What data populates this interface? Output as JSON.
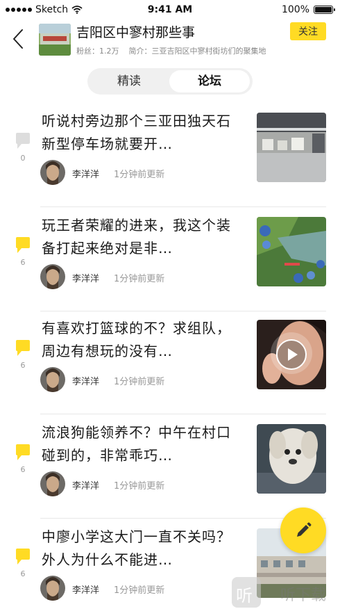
{
  "status_bar": {
    "carrier": "Sketch",
    "time": "9:41 AM",
    "battery": "100%"
  },
  "header": {
    "title": "吉阳区中寥村那些事",
    "fans_label": "粉丝：1.2万",
    "intro_label": "简介：三亚吉阳区中寥村街坊们的聚集地",
    "follow_label": "关注"
  },
  "tabs": [
    {
      "label": "精读",
      "active": false
    },
    {
      "label": "论坛",
      "active": true
    }
  ],
  "posts": [
    {
      "title": "听说村旁边那个三亚田独天石新型停车场就要开…",
      "comments": "0",
      "author": "李洋洋",
      "time": "1分钟前更新",
      "image": "warehouse-photo",
      "bubble_color": "#dddddd"
    },
    {
      "title": "玩王者荣耀的进来，我这个装备打起来绝对是非…",
      "comments": "6",
      "author": "李洋洋",
      "time": "1分钟前更新",
      "image": "game-screenshot",
      "bubble_color": "#ffdb24"
    },
    {
      "title": "有喜欢打篮球的不？求组队，周边有想玩的没有…",
      "comments": "6",
      "author": "李洋洋",
      "time": "1分钟前更新",
      "image": "video-thumbnail",
      "bubble_color": "#ffdb24"
    },
    {
      "title": "流浪狗能领养不？中午在村口碰到的，非常乖巧…",
      "comments": "6",
      "author": "李洋洋",
      "time": "1分钟前更新",
      "image": "dog-photo",
      "bubble_color": "#ffdb24"
    },
    {
      "title": "中廖小学这大门一直不关吗？外人为什么不能进…",
      "comments": "6",
      "author": "李洋洋",
      "time": "1分钟前更新",
      "image": "school-gate-photo",
      "bubble_color": "#ffdb24"
    }
  ],
  "fab": {
    "icon": "pencil-icon",
    "color": "#ffdb24"
  },
  "watermark": {
    "text": "听下载",
    "glyph": "听"
  },
  "colors": {
    "accent": "#ffdb24",
    "muted": "#999999"
  }
}
